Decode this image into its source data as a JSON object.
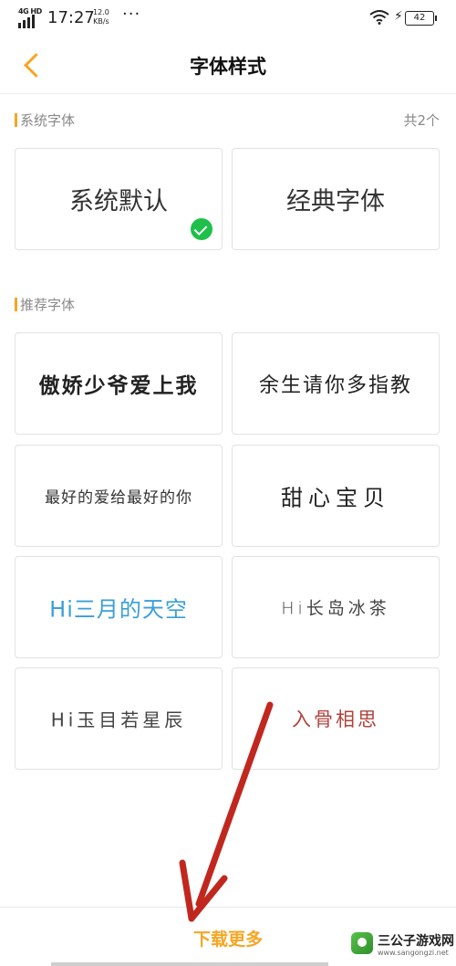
{
  "status_bar": {
    "network": "4G HD",
    "time": "17:27",
    "speed_value": "12.0",
    "speed_unit": "KB/s",
    "more": "···",
    "battery": "42"
  },
  "header": {
    "title": "字体样式"
  },
  "system_section": {
    "title": "系统字体",
    "count": "共2个"
  },
  "system_fonts": [
    {
      "label": "系统默认",
      "selected": true
    },
    {
      "label": "经典字体",
      "selected": false
    }
  ],
  "recommended_section": {
    "title": "推荐字体"
  },
  "recommended_fonts": [
    {
      "label": "傲娇少爷爱上我"
    },
    {
      "label": "余生请你多指教"
    },
    {
      "label": "最好的爱给最好的你"
    },
    {
      "label": "甜心宝贝"
    },
    {
      "label": "Hi三月的天空"
    },
    {
      "label": "Hi长岛冰茶"
    },
    {
      "label": "Hi玉目若星辰"
    },
    {
      "label": "入骨相思"
    }
  ],
  "bottom": {
    "download_more": "下载更多"
  },
  "watermark": {
    "title": "三公子游戏网",
    "url": "www.sangongzi.net"
  },
  "colors": {
    "accent": "#f5a623",
    "check": "#1ec04a",
    "arrow": "#c0281f"
  }
}
